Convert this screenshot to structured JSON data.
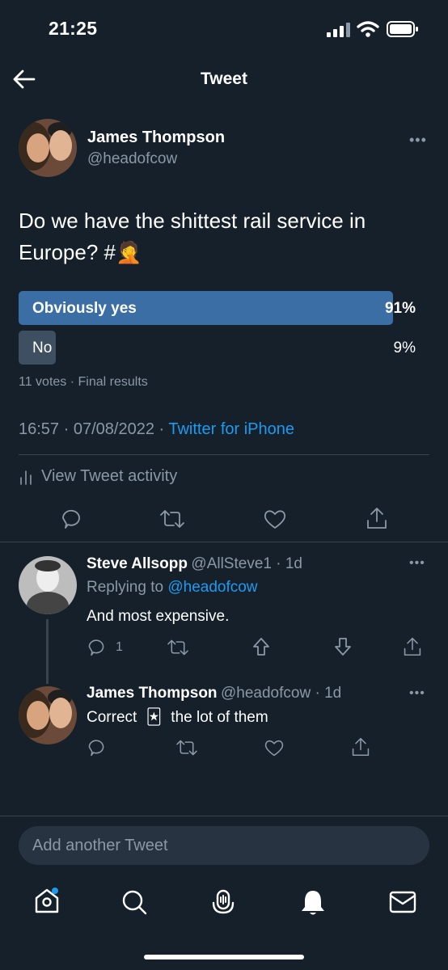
{
  "status_bar": {
    "time": "21:25"
  },
  "header": {
    "title": "Tweet"
  },
  "main_tweet": {
    "author_name": "James Thompson",
    "author_handle": "@headofcow",
    "text": "Do we have the shittest rail service in Europe? #",
    "text_emoji": "🤦",
    "poll": {
      "options": [
        {
          "label": "Obviously yes",
          "percent": "91%",
          "fraction": 0.91
        },
        {
          "label": "No",
          "percent": "9%",
          "fraction": 0.09
        }
      ],
      "votes": "11 votes",
      "status": "Final results"
    },
    "time": "16:57",
    "date": "07/08/2022",
    "source": "Twitter for iPhone",
    "activity_label": "View Tweet activity"
  },
  "replies": [
    {
      "author_name": "Steve Allsopp",
      "author_handle": "@AllSteve1",
      "age": "1d",
      "replying_prefix": "Replying to",
      "replying_to": "@headofcow",
      "text": "And most expensive.",
      "reply_count": "1"
    },
    {
      "author_name": "James Thompson",
      "author_handle": "@headofcow",
      "age": "1d",
      "text_before": "Correct",
      "text_emoji": "🃏",
      "text_after": "the lot of them"
    }
  ],
  "compose": {
    "placeholder": "Add another Tweet"
  },
  "colors": {
    "background": "#15202b",
    "accent": "#1d9bf0",
    "poll_winner": "#3a6ea5",
    "poll_other": "#3d4f60",
    "muted": "#8b98a5"
  },
  "icons": [
    "back-arrow-icon",
    "more-icon",
    "reply-icon",
    "retweet-icon",
    "like-icon",
    "share-icon",
    "upvote-icon",
    "downvote-icon",
    "home-icon",
    "search-icon",
    "spaces-icon",
    "notifications-icon",
    "messages-icon"
  ]
}
